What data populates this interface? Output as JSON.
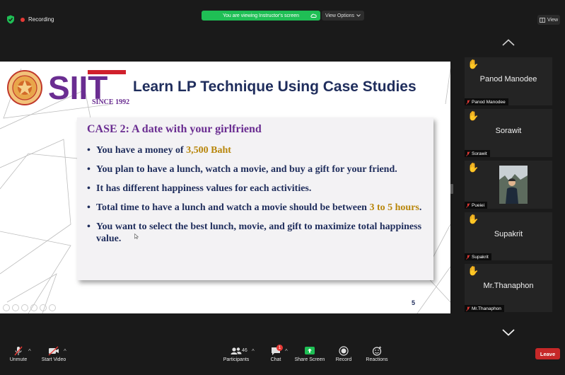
{
  "top_bar": {
    "recording_label": "Recording",
    "screen_banner": "You are viewing Instructor's screen",
    "view_options_label": "View Options",
    "view_button_label": "View"
  },
  "slide": {
    "logo_text": "SIIT",
    "logo_since": "SINCE 1992",
    "title": "Learn LP Technique Using Case Studies",
    "case_title": "CASE 2: A date with your girlfriend",
    "bullets": [
      {
        "pre": "You have a money of ",
        "hl": "3,500 Baht",
        "post": ""
      },
      {
        "pre": "You plan to have a lunch, watch a movie, and buy a gift for your friend.",
        "hl": "",
        "post": ""
      },
      {
        "pre": "It has different happiness values for each activities.",
        "hl": "",
        "post": ""
      },
      {
        "pre": "Total time to have a lunch and watch a movie should be between ",
        "hl": "3 to 5 hours",
        "post": "."
      },
      {
        "pre": "You want to select the best lunch, movie, and gift to maximize total happiness value.",
        "hl": "",
        "post": ""
      }
    ],
    "slide_number": "5",
    "colors": {
      "title": "#1f2d5c",
      "case": "#6a2d91",
      "highlight": "#b8860b",
      "logo_purple": "#6a2d91",
      "logo_red": "#d0202c"
    }
  },
  "participants": [
    {
      "name": "Panod Manodee",
      "label": "Panod Manodee",
      "hand": "✋",
      "has_video": false
    },
    {
      "name": "Sorawit",
      "label": "Sorawit",
      "hand": "✋",
      "has_video": false
    },
    {
      "name": "",
      "label": "Pueiei",
      "hand": "✋",
      "has_video": true
    },
    {
      "name": "Supakrit",
      "label": "Supakrit",
      "hand": "✋",
      "has_video": false
    },
    {
      "name": "Mr.Thanaphon",
      "label": "Mr.Thanaphon",
      "hand": "✋",
      "has_video": false
    }
  ],
  "toolbar": {
    "unmute_label": "Unmute",
    "start_video_label": "Start Video",
    "participants_label": "Participants",
    "participants_count": "46",
    "chat_label": "Chat",
    "chat_badge": "1",
    "share_screen_label": "Share Screen",
    "record_label": "Record",
    "reactions_label": "Reactions",
    "leave_label": "Leave",
    "share_color": "#1fbf55",
    "leave_color": "#c62828"
  }
}
